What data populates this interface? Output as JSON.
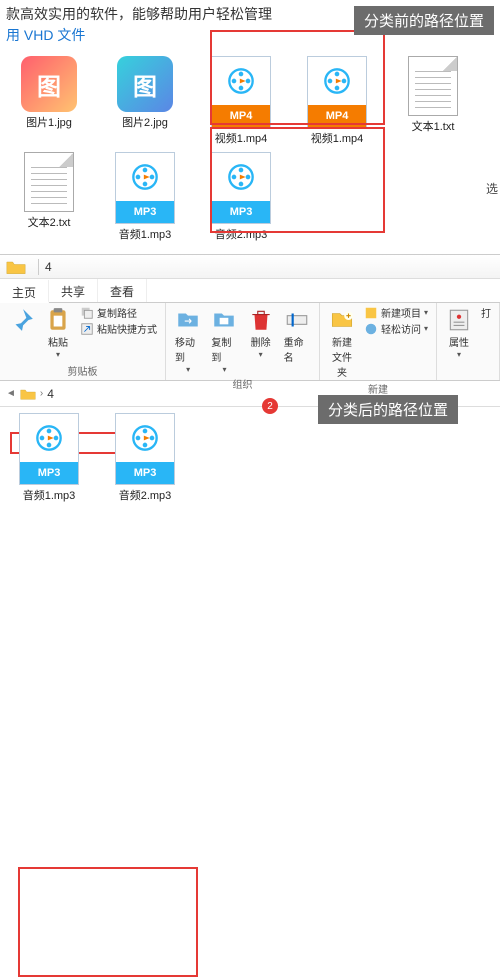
{
  "top": {
    "text_left": "款高效实用的软件，能够帮助用户轻松管理",
    "text_blue": "用 VHD 文件"
  },
  "annotations": {
    "before": "分类前的路径位置",
    "after": "分类后的路径位置",
    "marker2": "2"
  },
  "side": {
    "char1": "选"
  },
  "files_before": [
    {
      "label": "图片1.jpg",
      "kind": "tu1"
    },
    {
      "label": "图片2.jpg",
      "kind": "tu2"
    },
    {
      "label": "视频1.mp4",
      "kind": "mp4"
    },
    {
      "label": "视频1.mp4",
      "kind": "mp4"
    },
    {
      "label": "文本1.txt",
      "kind": "txt"
    },
    {
      "label": "文本2.txt",
      "kind": "txt"
    },
    {
      "label": "音频1.mp3",
      "kind": "mp3"
    },
    {
      "label": "音频2.mp3",
      "kind": "mp3"
    }
  ],
  "files_after": [
    {
      "label": "音频1.mp3",
      "kind": "mp3"
    },
    {
      "label": "音频2.mp3",
      "kind": "mp3"
    }
  ],
  "media_tags": {
    "mp4": "MP4",
    "mp3": "MP3"
  },
  "tu_text": "图",
  "explorer": {
    "title": "4",
    "tabs": {
      "home": "主页",
      "share": "共享",
      "view": "查看"
    },
    "ribbon": {
      "clipboard": {
        "paste": "粘贴",
        "copy_path": "复制路径",
        "paste_shortcut": "粘贴快捷方式",
        "label": "剪贴板"
      },
      "organize": {
        "move_to": "移动到",
        "copy_to": "复制到",
        "delete": "删除",
        "rename": "重命名",
        "label": "组织"
      },
      "new": {
        "new_folder": "新建\n文件夹",
        "new_item": "新建项目",
        "easy_access": "轻松访问",
        "label": "新建"
      },
      "open": {
        "properties": "属性",
        "open": "打",
        "label": ""
      }
    },
    "breadcrumb": {
      "item": "4"
    }
  }
}
